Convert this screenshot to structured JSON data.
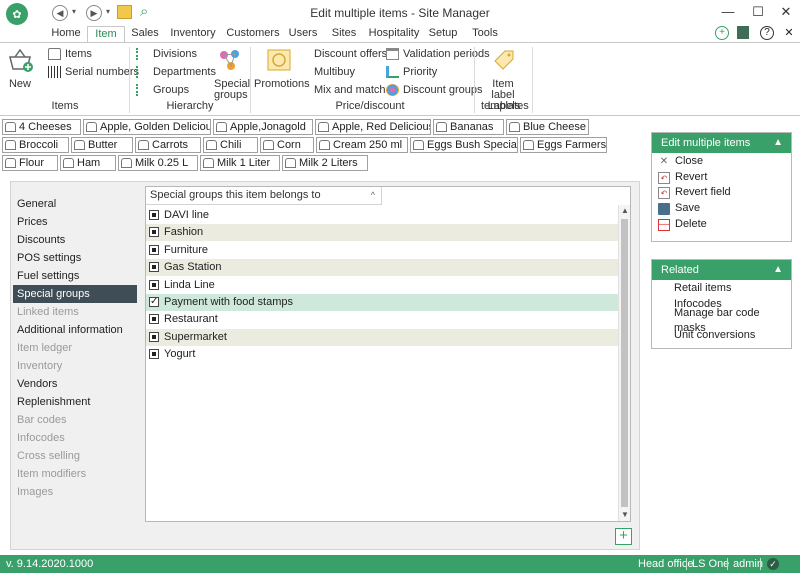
{
  "window": {
    "title": "Edit multiple items - Site Manager"
  },
  "tabs": [
    "Home",
    "Item",
    "Sales",
    "Inventory",
    "Customers",
    "Users",
    "Sites",
    "Hospitality",
    "Setup",
    "Tools"
  ],
  "ribbon": {
    "new_label": "New",
    "items_group": {
      "label": "Items",
      "items": [
        "Items",
        "Serial numbers"
      ]
    },
    "hierarchy_group": {
      "label": "Hierarchy",
      "items": [
        "Divisions",
        "Departments",
        "Groups"
      ],
      "special_groups": "Special groups"
    },
    "promotions_label": "Promotions",
    "price_group": {
      "label": "Price/discount",
      "col1": [
        "Discount offers",
        "Multibuy",
        "Mix and match"
      ],
      "col2": [
        "Validation periods",
        "Priority",
        "Discount groups"
      ]
    },
    "labels_group": {
      "label": "Labels",
      "item_label_templates": "Item label templates"
    }
  },
  "items_rows": [
    [
      "4 Cheeses",
      "Apple, Golden Delicious",
      "Apple,Jonagold",
      "Apple, Red Delicious",
      "Bananas",
      "Blue Cheese"
    ],
    [
      "Broccoli",
      "Butter",
      "Carrots",
      "Chili",
      "Corn",
      "Cream 250 ml",
      "Eggs Bush Special",
      "Eggs Farmers"
    ],
    [
      "Flour",
      "Ham",
      "Milk 0.25 L",
      "Milk 1 Liter",
      "Milk 2 Liters"
    ]
  ],
  "nav": [
    {
      "label": "General",
      "enabled": true
    },
    {
      "label": "Prices",
      "enabled": true
    },
    {
      "label": "Discounts",
      "enabled": true
    },
    {
      "label": "POS settings",
      "enabled": true
    },
    {
      "label": "Fuel settings",
      "enabled": true
    },
    {
      "label": "Special groups",
      "enabled": true,
      "active": true
    },
    {
      "label": "Linked items",
      "enabled": false
    },
    {
      "label": "Additional information",
      "enabled": true
    },
    {
      "label": "Item ledger",
      "enabled": false
    },
    {
      "label": "Inventory",
      "enabled": false
    },
    {
      "label": "Vendors",
      "enabled": true
    },
    {
      "label": "Replenishment",
      "enabled": true
    },
    {
      "label": "Bar codes",
      "enabled": false
    },
    {
      "label": "Infocodes",
      "enabled": false
    },
    {
      "label": "Cross selling",
      "enabled": false
    },
    {
      "label": "Item modifiers",
      "enabled": false
    },
    {
      "label": "Images",
      "enabled": false
    }
  ],
  "special_groups": {
    "column_header": "Special groups this item belongs to",
    "rows": [
      {
        "label": "DAVI line",
        "state": "indeterminate"
      },
      {
        "label": "Fashion",
        "state": "indeterminate"
      },
      {
        "label": "Furniture",
        "state": "indeterminate"
      },
      {
        "label": "Gas Station",
        "state": "indeterminate"
      },
      {
        "label": "Linda Line",
        "state": "indeterminate"
      },
      {
        "label": "Payment with food stamps",
        "state": "checked",
        "selected": true
      },
      {
        "label": "Restaurant",
        "state": "indeterminate"
      },
      {
        "label": "Supermarket",
        "state": "indeterminate"
      },
      {
        "label": "Yogurt",
        "state": "indeterminate"
      }
    ]
  },
  "edit_panel": {
    "title": "Edit multiple items",
    "actions": [
      "Close",
      "Revert",
      "Revert field",
      "Save",
      "Delete"
    ]
  },
  "related_panel": {
    "title": "Related",
    "links": [
      "Retail items",
      "Infocodes",
      "Manage bar code masks",
      "Unit conversions"
    ]
  },
  "status": {
    "version": "v. 9.14.2020.1000",
    "site": "Head office",
    "product": "LS One",
    "user": "admin"
  },
  "colors": {
    "accent": "#3aa06a",
    "nav_active": "#3f4d57",
    "row_alt": "#ebebdf",
    "row_selected": "#cfe8dc"
  }
}
